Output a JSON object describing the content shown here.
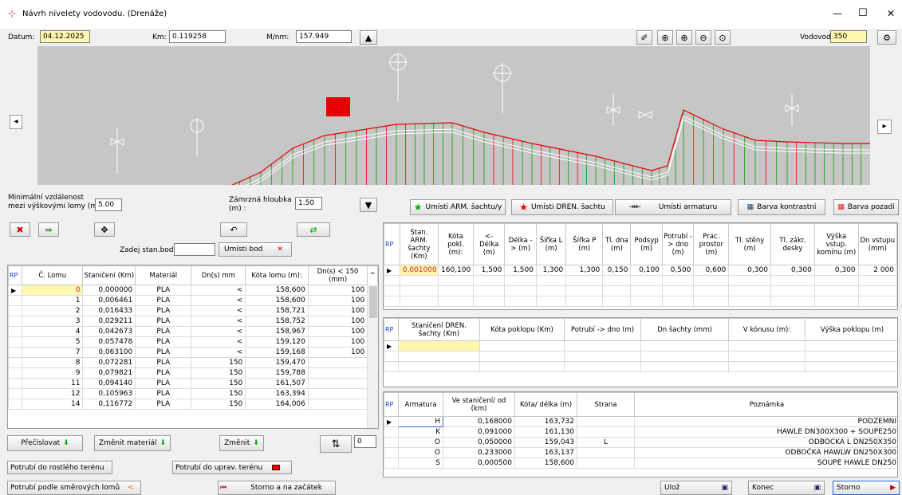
{
  "window": {
    "title": "Návrh nivelety vodovodu. (Drenáže)",
    "min": "—",
    "max": "☐",
    "close": "✕"
  },
  "top": {
    "datum_label": "Datum:",
    "datum": "04.12.2025",
    "km_label": "Km:",
    "km": "0.119258",
    "mnm_label": "M/nm:",
    "mnm": "157.949",
    "vodovod_label": "Vodovod:",
    "vodovod": "350"
  },
  "mid": {
    "min_label1": "Minimální vzdálenost",
    "min_label2": "mezi výškovými lomy (m)",
    "min_value": "5.00",
    "zamrz_label1": "Zámrzná hloubka",
    "zamrz_label2": "(m) :",
    "zamrz_value": "1.50",
    "zadej_label": "Zadej stan.bodu:",
    "umisti_bod": "Umísti bod"
  },
  "actions": {
    "arm": "Umísti ARM. šachtu/y",
    "dren": "Umísti DREN. šachtu",
    "armatura": "Umísti armaturu",
    "barva_k": "Barva kontrastní",
    "barva_p": "Barva pozadí"
  },
  "lomy": {
    "headers": [
      "RP",
      "Č. Lomu",
      "Staničení (Km)",
      "Materiál",
      "Dn(s) mm",
      "Kóta lomu (m):",
      "Dn(s) < 150 (mm)"
    ],
    "rows": [
      [
        "0",
        "0,000000",
        "PLA",
        "<",
        "158,600",
        "100"
      ],
      [
        "1",
        "0,006461",
        "PLA",
        "<",
        "158,600",
        "100"
      ],
      [
        "2",
        "0,016433",
        "PLA",
        "<",
        "158,721",
        "100"
      ],
      [
        "3",
        "0,029211",
        "PLA",
        "<",
        "158,752",
        "100"
      ],
      [
        "4",
        "0,042673",
        "PLA",
        "<",
        "158,967",
        "100"
      ],
      [
        "5",
        "0,057478",
        "PLA",
        "<",
        "159,120",
        "100"
      ],
      [
        "7",
        "0,063100",
        "PLA",
        "<",
        "159,168",
        "100"
      ],
      [
        "8",
        "0,072281",
        "PLA",
        "150",
        "159,470",
        ""
      ],
      [
        "9",
        "0,079821",
        "PLA",
        "150",
        "159,788",
        ""
      ],
      [
        "11",
        "0,094140",
        "PLA",
        "150",
        "161,507",
        ""
      ],
      [
        "12",
        "0,105963",
        "PLA",
        "150",
        "163,394",
        ""
      ],
      [
        "14",
        "0,116772",
        "PLA",
        "150",
        "164,006",
        ""
      ]
    ]
  },
  "arm": {
    "headers": [
      "RP",
      "Stan. ARM. šachty (Km)",
      "Kóta pokl. (m):",
      "<- Délka (m)",
      "Délka -> (m)",
      "Šířka L (m)",
      "Šířka P (m)",
      "Tl. dna (m)",
      "Podsyp (m)",
      "Potrubí -> dno (m)",
      "Prac. prostor (m)",
      "Tl. stěny (m)",
      "Tl. zákr. desky",
      "Výška vstup. komínu (m)",
      "Dn vstupu (mm)"
    ],
    "rows": [
      [
        "0,001000",
        "160,100",
        "1,500",
        "1,500",
        "1,300",
        "1,300",
        "0,150",
        "0,100",
        "0,500",
        "0,600",
        "0,300",
        "0,300",
        "0,300",
        "2 000"
      ]
    ]
  },
  "dren": {
    "headers": [
      "RP",
      "Staničení DREN. šachty (Km)",
      "Kóta poklopu (Km)",
      "Potrubí -> dno (m)",
      "Dn šachty (mm)",
      "V kónusu (m):",
      "Výška poklopu (m)"
    ]
  },
  "armatura": {
    "headers": [
      "RP",
      "Armatura",
      "Ve staničení/ od (km)",
      "Kóta/ délka (m)",
      "Strana",
      "Poznámka"
    ],
    "rows": [
      [
        "H",
        "0,168000",
        "163,732",
        "",
        "PODZEMNI"
      ],
      [
        "K",
        "0,091000",
        "161,130",
        "",
        "HAWLE DN300X300 + SOUPE250"
      ],
      [
        "O",
        "0,050000",
        "159,043",
        "L",
        "ODBOCKA L DN250X350"
      ],
      [
        "O",
        "0,233000",
        "163,137",
        "",
        "ODBOČKA HAWLW DN250X300"
      ],
      [
        "S",
        "0,000500",
        "158,600",
        "",
        "SOUPE HAWLE DN250"
      ]
    ]
  },
  "bottom": {
    "precislovat": "Přečíslovat",
    "zmenit_mat": "Změnit materiál",
    "zmenit": "Změnit",
    "stepper": "0",
    "rostly": "Potrubí do rostlého terénu",
    "upraveny": "Potrubí do uprav. terénu",
    "smerove": "Potrubí podle směrových lomů",
    "storno_zac": "Storno a na začátek",
    "uloz": "Ulož",
    "konec": "Konec",
    "storno": "Storno"
  },
  "colors": {
    "accent_red": "#e80000",
    "pipe_green": "#00a000",
    "input_yellow": "#fff7b0"
  },
  "chart_profile": {
    "terrain": [
      [
        0,
        192
      ],
      [
        20,
        190
      ],
      [
        50,
        188
      ],
      [
        100,
        186
      ],
      [
        150,
        185
      ],
      [
        200,
        182
      ],
      [
        240,
        176
      ],
      [
        280,
        158
      ],
      [
        320,
        128
      ],
      [
        360,
        112
      ],
      [
        400,
        106
      ],
      [
        450,
        98
      ],
      [
        520,
        96
      ],
      [
        560,
        108
      ],
      [
        620,
        122
      ],
      [
        700,
        138
      ],
      [
        770,
        156
      ],
      [
        790,
        150
      ],
      [
        810,
        80
      ],
      [
        860,
        104
      ],
      [
        900,
        118
      ],
      [
        940,
        120
      ],
      [
        1010,
        122
      ],
      [
        1044,
        122
      ]
    ]
  }
}
